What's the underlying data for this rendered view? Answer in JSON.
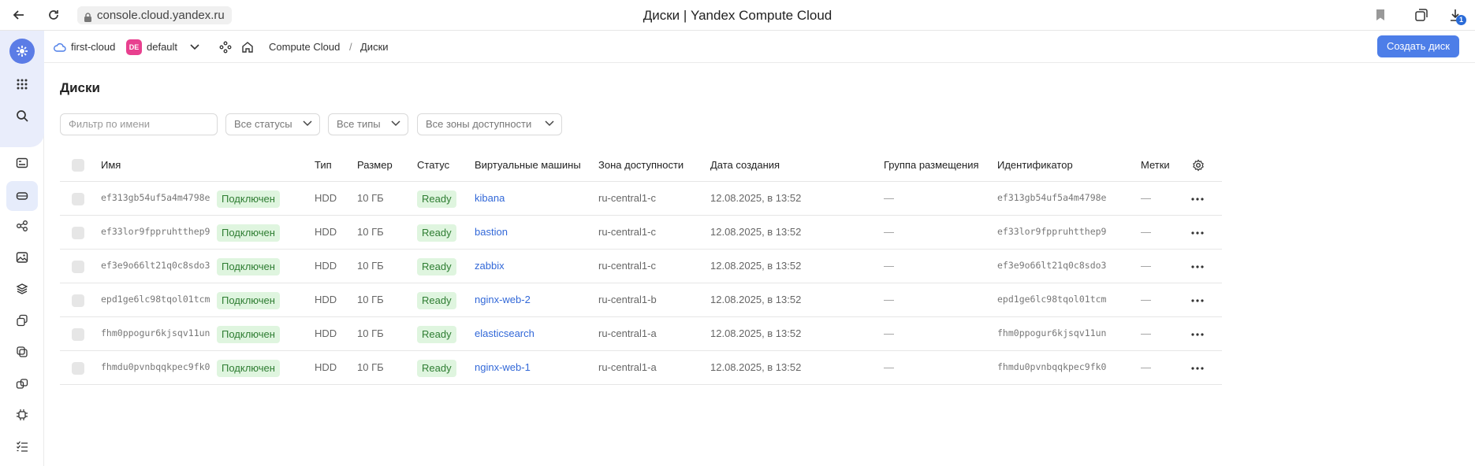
{
  "browser": {
    "url": "console.cloud.yandex.ru",
    "title": "Диски | Yandex Compute Cloud"
  },
  "header": {
    "cloud": "first-cloud",
    "folder_badge": "DE",
    "folder": "default",
    "service": "Compute Cloud",
    "separator": "/",
    "current": "Диски",
    "create_button": "Создать диск"
  },
  "page": {
    "title": "Диски"
  },
  "filters": {
    "name_placeholder": "Фильтр по имени",
    "status": "Все статусы",
    "type": "Все типы",
    "zone": "Все зоны доступности"
  },
  "columns": {
    "name": "Имя",
    "type": "Тип",
    "size": "Размер",
    "status": "Статус",
    "vms": "Виртуальные машины",
    "zone": "Зона доступности",
    "created": "Дата создания",
    "group": "Группа размещения",
    "id": "Идентификатор",
    "labels": "Метки"
  },
  "rows": [
    {
      "name": "ef313gb54uf5a4m4798e",
      "attached": "Подключен",
      "type": "HDD",
      "size": "10 ГБ",
      "status": "Ready",
      "vm": "kibana",
      "zone": "ru-central1-c",
      "created": "12.08.2025, в 13:52",
      "group": "—",
      "id": "ef313gb54uf5a4m4798e",
      "labels": "—"
    },
    {
      "name": "ef33lor9fppruhtthep9",
      "attached": "Подключен",
      "type": "HDD",
      "size": "10 ГБ",
      "status": "Ready",
      "vm": "bastion",
      "zone": "ru-central1-c",
      "created": "12.08.2025, в 13:52",
      "group": "—",
      "id": "ef33lor9fppruhtthep9",
      "labels": "—"
    },
    {
      "name": "ef3e9o66lt21q0c8sdo3",
      "attached": "Подключен",
      "type": "HDD",
      "size": "10 ГБ",
      "status": "Ready",
      "vm": "zabbix",
      "zone": "ru-central1-c",
      "created": "12.08.2025, в 13:52",
      "group": "—",
      "id": "ef3e9o66lt21q0c8sdo3",
      "labels": "—"
    },
    {
      "name": "epd1ge6lc98tqol01tcm",
      "attached": "Подключен",
      "type": "HDD",
      "size": "10 ГБ",
      "status": "Ready",
      "vm": "nginx-web-2",
      "zone": "ru-central1-b",
      "created": "12.08.2025, в 13:52",
      "group": "—",
      "id": "epd1ge6lc98tqol01tcm",
      "labels": "—"
    },
    {
      "name": "fhm0ppogur6kjsqv11un",
      "attached": "Подключен",
      "type": "HDD",
      "size": "10 ГБ",
      "status": "Ready",
      "vm": "elasticsearch",
      "zone": "ru-central1-a",
      "created": "12.08.2025, в 13:52",
      "group": "—",
      "id": "fhm0ppogur6kjsqv11un",
      "labels": "—"
    },
    {
      "name": "fhmdu0pvnbqqkpec9fk0",
      "attached": "Подключен",
      "type": "HDD",
      "size": "10 ГБ",
      "status": "Ready",
      "vm": "nginx-web-1",
      "zone": "ru-central1-a",
      "created": "12.08.2025, в 13:52",
      "group": "—",
      "id": "fhmdu0pvnbqqkpec9fk0",
      "labels": "—"
    }
  ],
  "colors": {
    "accent": "#4d7ee8",
    "status_bg": "#dff5df",
    "status_text": "#2e7d32",
    "link": "#3268d8"
  }
}
